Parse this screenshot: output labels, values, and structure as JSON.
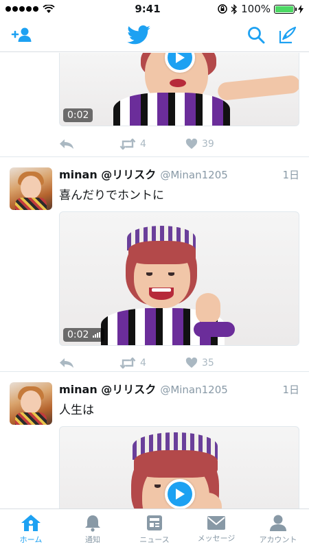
{
  "colors": {
    "accent": "#1da1f2",
    "muted": "#aab8c2",
    "text": "#14171a",
    "battery": "#4cd964"
  },
  "status_bar": {
    "time": "9:41",
    "battery_text": "100%"
  },
  "nav": {
    "left_icon": "add-user-icon",
    "center_icon": "twitter-bird-icon",
    "right_icons": [
      "search-icon",
      "compose-icon"
    ]
  },
  "tweets": [
    {
      "duration": "0:02",
      "retweets": "4",
      "likes": "39"
    },
    {
      "name": "minan @リリスク",
      "handle": "@Minan1205",
      "time": "1日",
      "text": "喜んだりでホントに",
      "duration": "0:02",
      "retweets": "4",
      "likes": "35"
    },
    {
      "name": "minan @リリスク",
      "handle": "@Minan1205",
      "time": "1日",
      "text": "人生は"
    }
  ],
  "tabs": [
    {
      "label": "ホーム",
      "icon": "home-icon",
      "active": true
    },
    {
      "label": "通知",
      "icon": "bell-icon",
      "active": false
    },
    {
      "label": "ニュース",
      "icon": "news-icon",
      "active": false
    },
    {
      "label": "メッセージ",
      "icon": "envelope-icon",
      "active": false
    },
    {
      "label": "アカウント",
      "icon": "person-icon",
      "active": false
    }
  ]
}
